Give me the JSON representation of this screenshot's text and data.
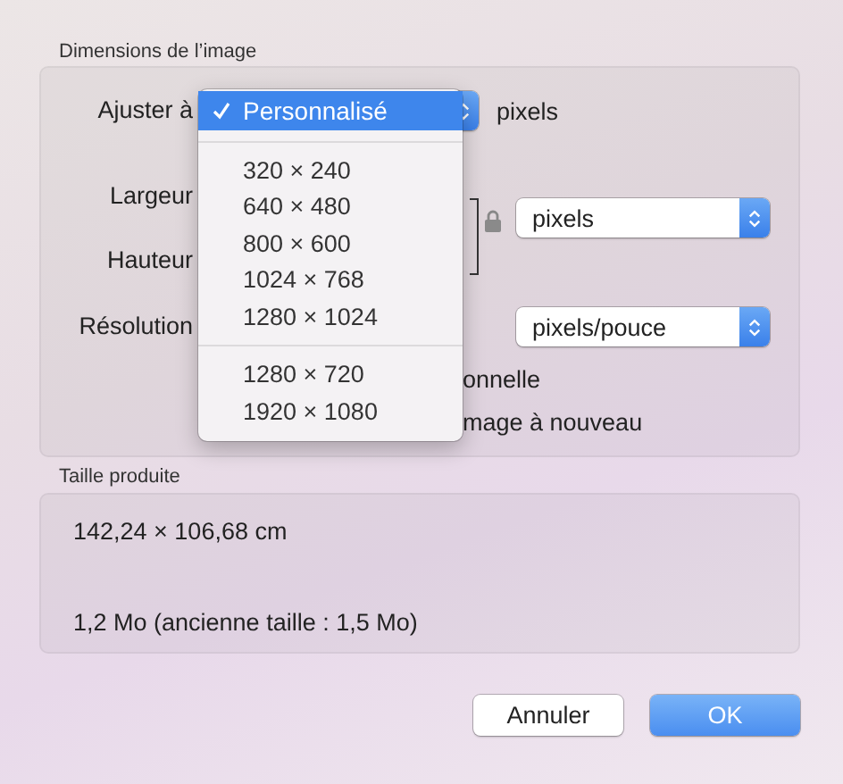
{
  "dimensions_section": {
    "title": "Dimensions de l’image",
    "fit_label": "Ajuster à",
    "fit_unit": "pixels",
    "width_label": "Largeur",
    "height_label": "Hauteur",
    "size_unit_popup": "pixels",
    "resolution_label": "Résolution",
    "resolution_unit_popup": "pixels/pouce",
    "checkboxes": [
      {
        "label": "onnelle"
      },
      {
        "label": "mage à nouveau"
      }
    ]
  },
  "fit_menu": {
    "groups": [
      {
        "items": [
          {
            "label": "Personnalisé",
            "selected": true
          }
        ]
      },
      {
        "items": [
          {
            "label": "320 × 240",
            "selected": false
          },
          {
            "label": "640 × 480",
            "selected": false
          },
          {
            "label": "800 × 600",
            "selected": false
          },
          {
            "label": "1024 × 768",
            "selected": false
          },
          {
            "label": "1280 × 1024",
            "selected": false
          }
        ]
      },
      {
        "items": [
          {
            "label": "1280 × 720",
            "selected": false
          },
          {
            "label": "1920 × 1080",
            "selected": false
          }
        ]
      }
    ]
  },
  "output_section": {
    "title": "Taille produite",
    "dimensions": "142,24 × 106,68 cm",
    "file_size": "1,2 Mo (ancienne taille : 1,5 Mo)"
  },
  "buttons": [
    {
      "label": "Annuler",
      "kind": "secondary"
    },
    {
      "label": "OK",
      "kind": "primary"
    }
  ]
}
